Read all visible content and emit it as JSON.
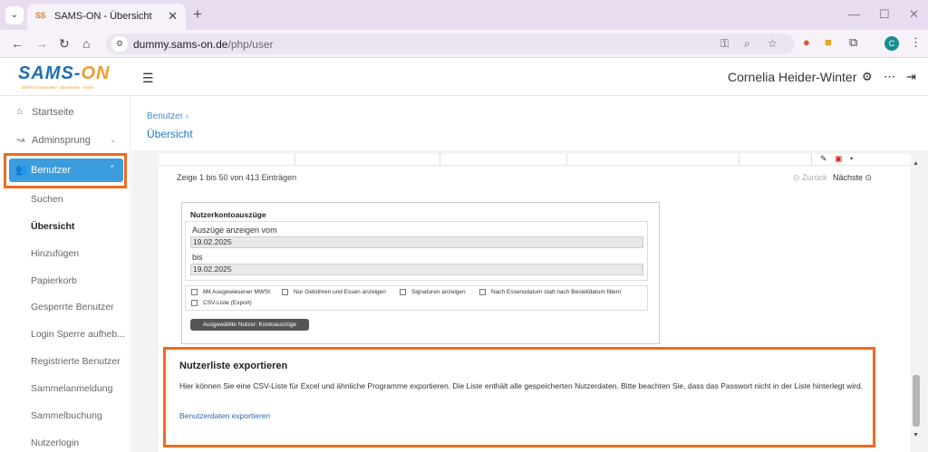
{
  "browser": {
    "tab_title": "SAMS-ON - Übersicht",
    "tab_favicon": "SS",
    "new_tab": "+",
    "url_domain": "dummy.sams-on.de",
    "url_path": "/php/user",
    "profile_initial": "C"
  },
  "header": {
    "logo": "SAMS-ON",
    "logo_main": "SAMS-",
    "logo_on": "ON",
    "logo_tagline": "EINFACH bestellen - abrechnen - essen",
    "user_name": "Cornelia Heider-Winter"
  },
  "sidebar": {
    "startseite": "Startseite",
    "adminsprung": "Adminsprung",
    "benutzer": "Benutzer",
    "sub_items": [
      "Suchen",
      "Übersicht",
      "Hinzufügen",
      "Papierkorb",
      "Gesperrte Benutzer",
      "Login Sperre aufheb...",
      "Registrierte Benutzer",
      "Sammelanmeldung",
      "Sammelbuchung",
      "Nutzerlogin"
    ],
    "active_sub": "Übersicht"
  },
  "main": {
    "breadcrumb": "Benutzer",
    "page_title": "Übersicht",
    "entries_text": "Zeige 1 bis 50 von 413 Einträgen",
    "prev_label": "Zurück",
    "next_label": "Nächste"
  },
  "kontoauszuege": {
    "title": "Nutzerkontoauszüge",
    "from_label": "Auszüge anzeigen vom",
    "from_value": "19.02.2025",
    "to_label": "bis",
    "to_value": "19.02.2025",
    "checkboxes": [
      "Mit Ausgewiesener MWSt",
      "Nur Gebühren und Essen anzeigen",
      "Signaturen anzeigen",
      "Nach Essensdatum statt nach Bestelldatum filtern",
      "CSV-Liste (Export)"
    ],
    "button_label": "Ausgewählte Nutzer: Kontoauszüge"
  },
  "export": {
    "title": "Nutzerliste exportieren",
    "description": "Hier können Sie eine CSV-Liste für Excel und ähnliche Programme exportieren. Die Liste enthält alle gespeicherten Nutzerdaten. Bitte beachten Sie, dass das Passwort nicht in der Liste hinterlegt wird.",
    "link_label": "Benutzerdaten exportieren"
  },
  "colors": {
    "accent_blue": "#3b9cde",
    "highlight_orange": "#f06a1c",
    "link_blue": "#2e64b3"
  }
}
